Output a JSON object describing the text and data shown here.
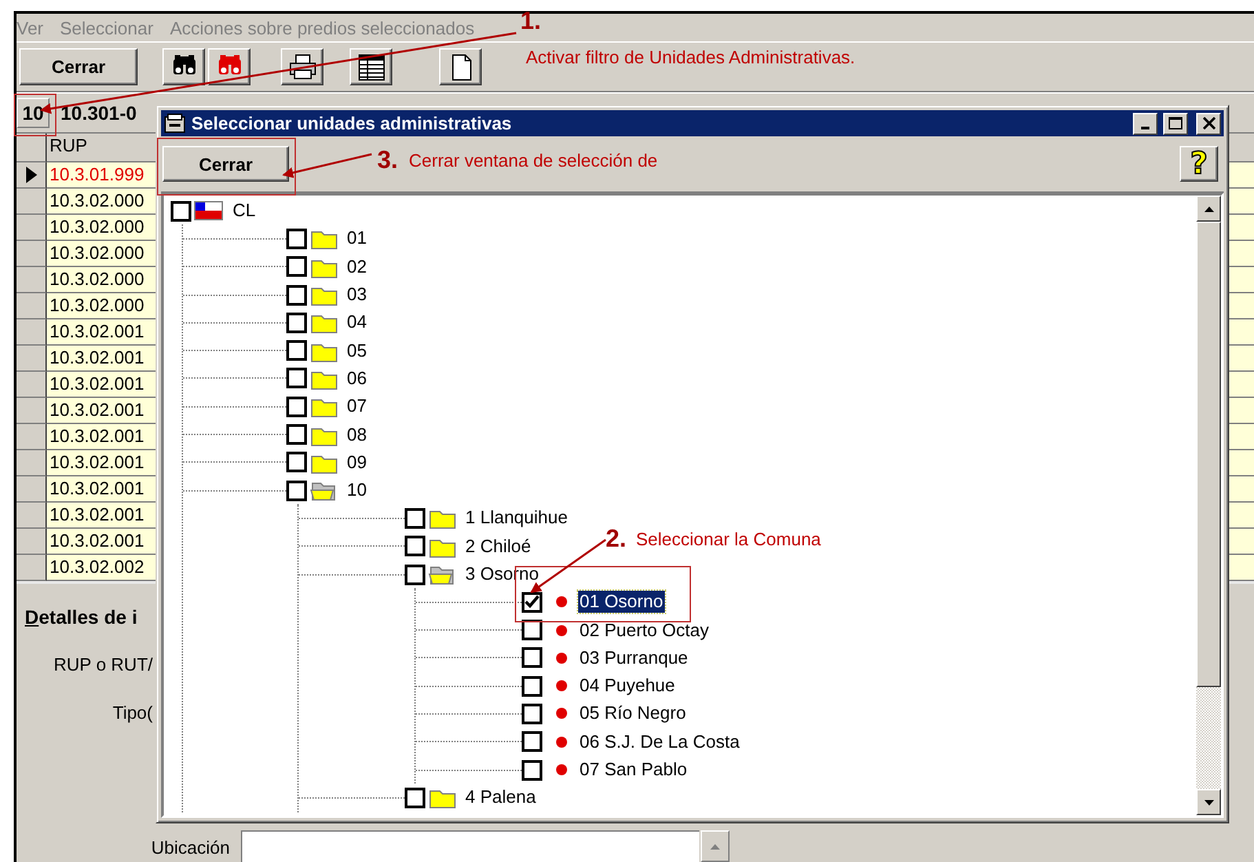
{
  "menu": [
    {
      "label": "Ver",
      "disabled": true
    },
    {
      "label": "Seleccionar",
      "disabled": true
    },
    {
      "label": "Acciones sobre predios seleccionados",
      "disabled": true
    }
  ],
  "toolbar": {
    "close_button": "Cerrar"
  },
  "record": {
    "badge": "10",
    "code": "10.301-0"
  },
  "grid": {
    "columns": [
      "RUP"
    ],
    "rows": [
      {
        "rup": "10.3.01.999",
        "current": true
      },
      {
        "rup": "10.3.02.000",
        "current": false
      },
      {
        "rup": "10.3.02.000",
        "current": false
      },
      {
        "rup": "10.3.02.000",
        "current": false
      },
      {
        "rup": "10.3.02.000",
        "current": false
      },
      {
        "rup": "10.3.02.000",
        "current": false
      },
      {
        "rup": "10.3.02.001",
        "current": false
      },
      {
        "rup": "10.3.02.001",
        "current": false
      },
      {
        "rup": "10.3.02.001",
        "current": false
      },
      {
        "rup": "10.3.02.001",
        "current": false
      },
      {
        "rup": "10.3.02.001",
        "current": false
      },
      {
        "rup": "10.3.02.001",
        "current": false
      },
      {
        "rup": "10.3.02.001",
        "current": false
      },
      {
        "rup": "10.3.02.001",
        "current": false
      },
      {
        "rup": "10.3.02.001",
        "current": false
      },
      {
        "rup": "10.3.02.002",
        "current": false
      }
    ]
  },
  "details": {
    "title": "Detalles de i",
    "fields": [
      {
        "label": "RUP o RUT/"
      },
      {
        "label": "Tipo("
      }
    ],
    "location": {
      "label": "Ubicación"
    }
  },
  "dialog": {
    "title": "Seleccionar unidades administrativas",
    "close_button": "Cerrar",
    "help_button": "?",
    "tree": [
      {
        "label": "CL",
        "kind": "country",
        "checked": false,
        "selected": false,
        "children": [
          {
            "label": "01",
            "kind": "folder",
            "checked": false,
            "selected": false,
            "expanded": false
          },
          {
            "label": "02",
            "kind": "folder",
            "checked": false,
            "selected": false,
            "expanded": false
          },
          {
            "label": "03",
            "kind": "folder",
            "checked": false,
            "selected": false,
            "expanded": false
          },
          {
            "label": "04",
            "kind": "folder",
            "checked": false,
            "selected": false,
            "expanded": false
          },
          {
            "label": "05",
            "kind": "folder",
            "checked": false,
            "selected": false,
            "expanded": false
          },
          {
            "label": "06",
            "kind": "folder",
            "checked": false,
            "selected": false,
            "expanded": false
          },
          {
            "label": "07",
            "kind": "folder",
            "checked": false,
            "selected": false,
            "expanded": false
          },
          {
            "label": "08",
            "kind": "folder",
            "checked": false,
            "selected": false,
            "expanded": false
          },
          {
            "label": "09",
            "kind": "folder",
            "checked": false,
            "selected": false,
            "expanded": false
          },
          {
            "label": "10",
            "kind": "folder",
            "checked": false,
            "selected": false,
            "expanded": true,
            "children": [
              {
                "label": "1 Llanquihue",
                "kind": "folder",
                "checked": false,
                "selected": false,
                "expanded": false
              },
              {
                "label": "2 Chiloé",
                "kind": "folder",
                "checked": false,
                "selected": false,
                "expanded": false
              },
              {
                "label": "3 Osorno",
                "kind": "folder",
                "checked": false,
                "selected": false,
                "expanded": true,
                "children": [
                  {
                    "label": "01 Osorno",
                    "kind": "commune",
                    "checked": true,
                    "selected": true
                  },
                  {
                    "label": "02 Puerto Octay",
                    "kind": "commune",
                    "checked": false,
                    "selected": false
                  },
                  {
                    "label": "03 Purranque",
                    "kind": "commune",
                    "checked": false,
                    "selected": false
                  },
                  {
                    "label": "04 Puyehue",
                    "kind": "commune",
                    "checked": false,
                    "selected": false
                  },
                  {
                    "label": "05 Río Negro",
                    "kind": "commune",
                    "checked": false,
                    "selected": false
                  },
                  {
                    "label": "06 S.J. De La Costa",
                    "kind": "commune",
                    "checked": false,
                    "selected": false
                  },
                  {
                    "label": "07 San Pablo",
                    "kind": "commune",
                    "checked": false,
                    "selected": false
                  }
                ]
              },
              {
                "label": "4 Palena",
                "kind": "folder",
                "checked": false,
                "selected": false,
                "expanded": false
              }
            ]
          }
        ]
      }
    ]
  },
  "annotations": [
    {
      "number": "1.",
      "text": "Activar filtro de Unidades Administrativas."
    },
    {
      "number": "2.",
      "text": "Seleccionar la Comuna"
    },
    {
      "number": "3.",
      "text": "Cerrar ventana de selección de"
    }
  ]
}
